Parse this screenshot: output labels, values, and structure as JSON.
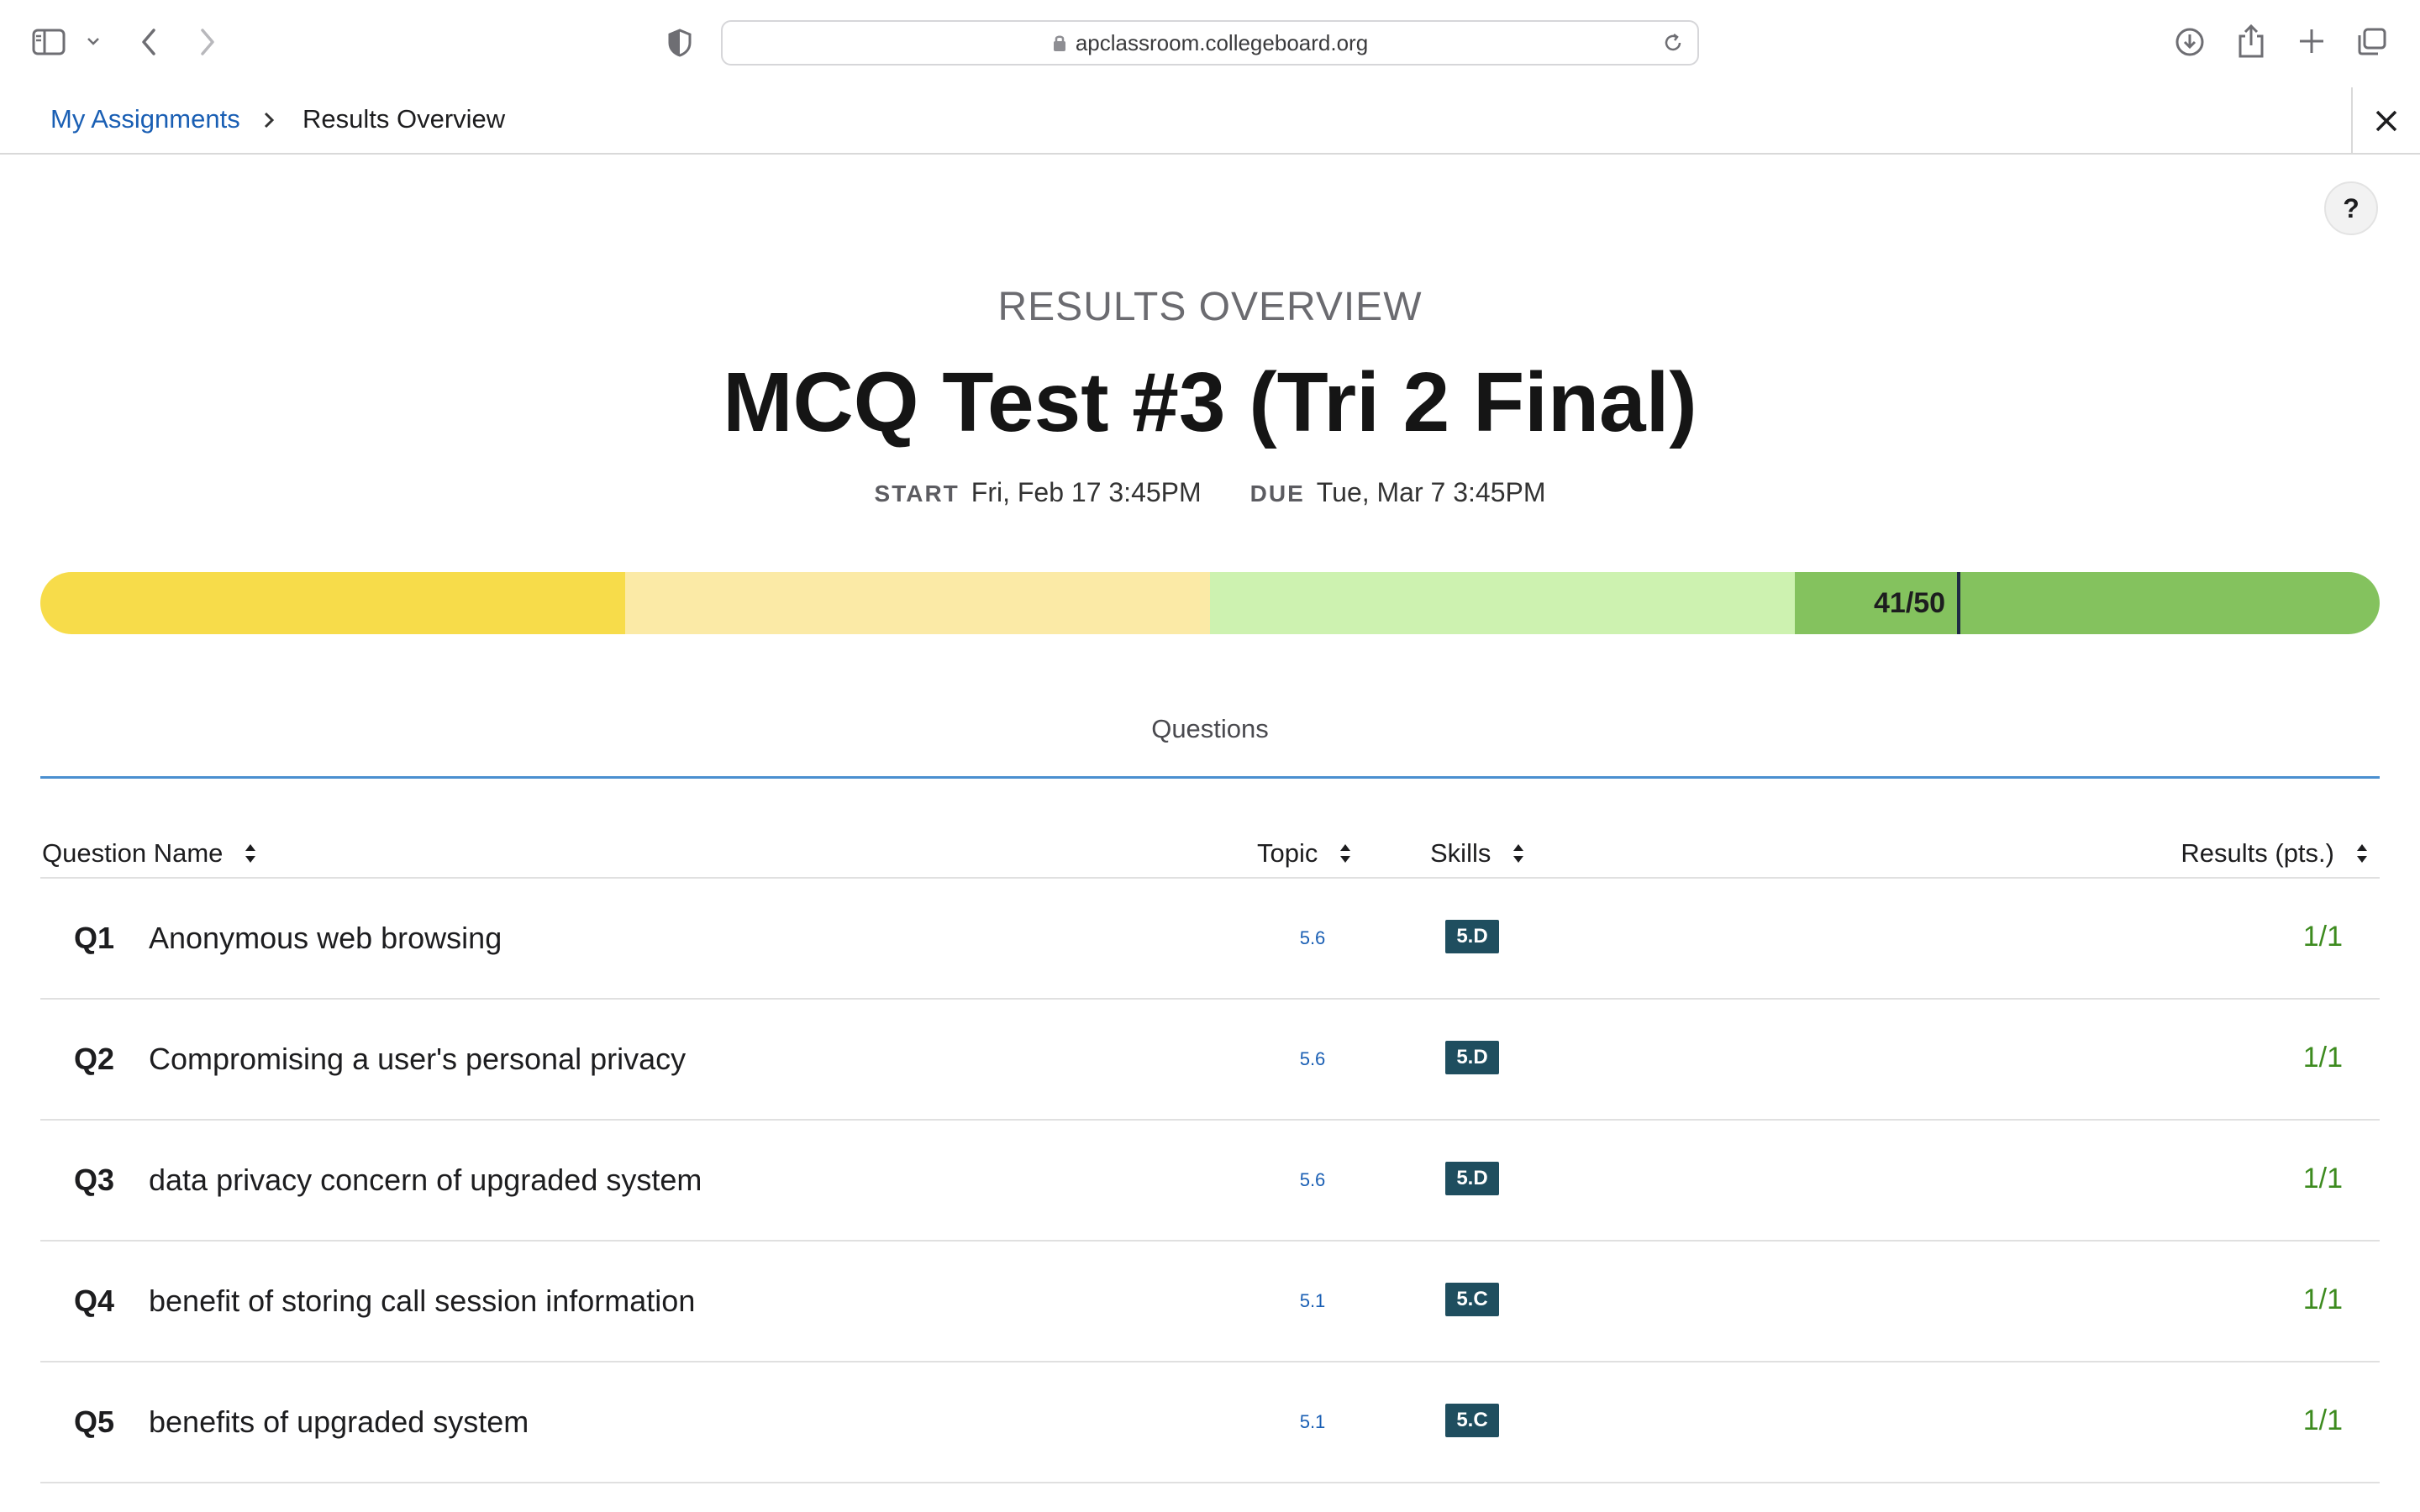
{
  "browser": {
    "url": "apclassroom.collegeboard.org"
  },
  "breadcrumb": {
    "link": "My Assignments",
    "current": "Results Overview"
  },
  "help": {
    "label": "?"
  },
  "header": {
    "kicker": "RESULTS OVERVIEW",
    "title": "MCQ Test #3 (Tri 2 Final)",
    "start_label": "START",
    "start_value": "Fri, Feb 17 3:45PM",
    "due_label": "DUE",
    "due_value": "Tue, Mar 7 3:45PM"
  },
  "score": {
    "label": "41/50",
    "earned": 41,
    "total": 50,
    "band_colors": [
      "#f7dc4a",
      "#fbeaa6",
      "#cdf2b0",
      "#84c25e"
    ]
  },
  "tabs": {
    "questions": "Questions"
  },
  "table": {
    "headers": {
      "question_name": "Question Name",
      "topic": "Topic",
      "skills": "Skills",
      "results": "Results (pts.)"
    },
    "rows": [
      {
        "num": "Q1",
        "name": "Anonymous web browsing",
        "topic": "5.6",
        "skill": "5.D",
        "result": "1/1"
      },
      {
        "num": "Q2",
        "name": "Compromising a user's personal privacy",
        "topic": "5.6",
        "skill": "5.D",
        "result": "1/1"
      },
      {
        "num": "Q3",
        "name": "data privacy concern of upgraded system",
        "topic": "5.6",
        "skill": "5.D",
        "result": "1/1"
      },
      {
        "num": "Q4",
        "name": "benefit of storing call session information",
        "topic": "5.1",
        "skill": "5.C",
        "result": "1/1"
      },
      {
        "num": "Q5",
        "name": "benefits of upgraded system",
        "topic": "5.1",
        "skill": "5.C",
        "result": "1/1"
      }
    ]
  },
  "icons": {
    "sidebar": "sidebar-icon",
    "back": "chevron-left-icon",
    "forward": "chevron-right-icon",
    "privacy": "shield-icon",
    "lock": "lock-icon",
    "reload": "reload-icon",
    "download": "download-icon",
    "share": "share-icon",
    "new_tab": "plus-icon",
    "tabs": "tabs-overview-icon",
    "close": "close-icon",
    "sort": "sort-icon"
  }
}
